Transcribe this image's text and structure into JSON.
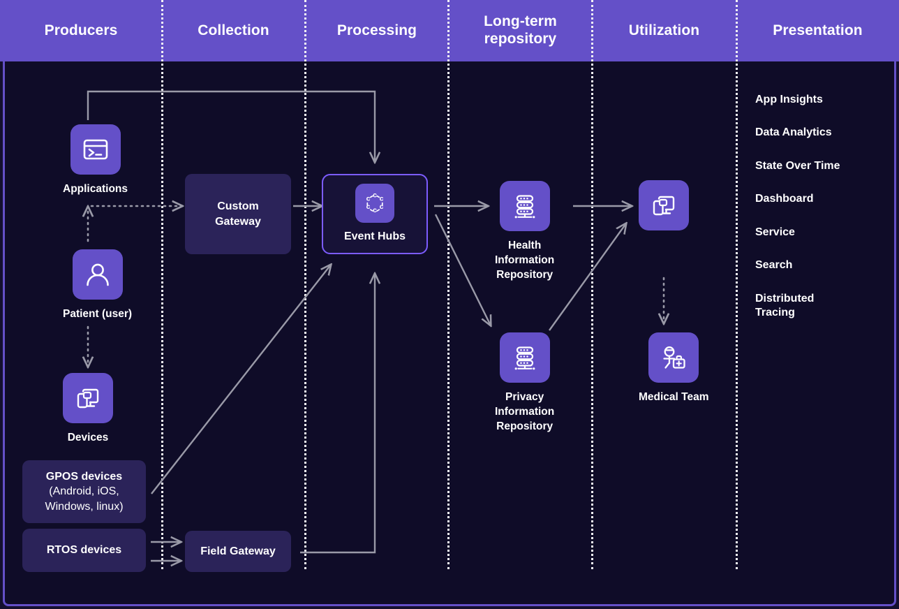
{
  "colors": {
    "header_band": "#6450c8",
    "canvas": "#0f0c28",
    "page": "#14102e",
    "tile_purple": "#6450c8",
    "box_navy": "#2b2359",
    "accent_border": "#7c5cff",
    "connector": "#9a9aa8",
    "divider": "#f2f2f5",
    "text": "#ffffff"
  },
  "header": {
    "columns": [
      {
        "label": "Producers"
      },
      {
        "label": "Collection"
      },
      {
        "label": "Processing"
      },
      {
        "label": "Long-term\nrepository"
      },
      {
        "label": "Utilization"
      },
      {
        "label": "Presentation"
      }
    ]
  },
  "producers": {
    "applications": {
      "label": "Applications",
      "icon": "terminal-window-icon"
    },
    "patient": {
      "label": "Patient (user)",
      "icon": "person-icon"
    },
    "devices": {
      "label": "Devices",
      "icon": "devices-icon"
    },
    "gpos_devices": {
      "title": "GPOS devices",
      "detail": "(Android, iOS,\nWindows, linux)"
    },
    "rtos_devices": {
      "label": "RTOS devices"
    }
  },
  "collection": {
    "custom_gateway": {
      "label": "Custom\nGateway"
    },
    "field_gateway": {
      "label": "Field Gateway"
    }
  },
  "processing": {
    "event_hubs": {
      "label": "Event Hubs",
      "icon": "event-hubs-icon"
    }
  },
  "repository": {
    "health_information_repository": {
      "label": "Health\nInformation\nRepository",
      "icon": "database-stack-icon"
    },
    "privacy_information_repository": {
      "label": "Privacy\nInformation\nRepository",
      "icon": "database-stack-icon"
    }
  },
  "utilization": {
    "devices": {
      "label": "",
      "icon": "devices-icon"
    },
    "medical_team": {
      "label": "Medical Team",
      "icon": "medical-team-icon"
    }
  },
  "presentation": {
    "items": [
      {
        "label": "App Insights"
      },
      {
        "label": "Data Analytics"
      },
      {
        "label": "State Over Time"
      },
      {
        "label": "Dashboard"
      },
      {
        "label": "Service"
      },
      {
        "label": "Search"
      },
      {
        "label": "Distributed\nTracing"
      }
    ]
  },
  "connections": [
    {
      "from": "applications",
      "to": "event-hubs",
      "style": "solid-elbow"
    },
    {
      "from": "patient",
      "to": "applications",
      "style": "dotted"
    },
    {
      "from": "patient",
      "to": "devices",
      "style": "dotted"
    },
    {
      "from": "applications",
      "to": "custom-gateway",
      "style": "dotted"
    },
    {
      "from": "custom-gateway",
      "to": "event-hubs",
      "style": "solid"
    },
    {
      "from": "gpos-devices",
      "to": "event-hubs",
      "style": "solid-diagonal"
    },
    {
      "from": "rtos-devices",
      "to": "field-gateway",
      "style": "solid"
    },
    {
      "from": "field-gateway",
      "to": "event-hubs",
      "style": "solid-elbow"
    },
    {
      "from": "event-hubs",
      "to": "health-information-repository",
      "style": "solid"
    },
    {
      "from": "event-hubs",
      "to": "privacy-information-repository",
      "style": "solid-diagonal"
    },
    {
      "from": "health-information-repository",
      "to": "utilization-devices",
      "style": "solid"
    },
    {
      "from": "privacy-information-repository",
      "to": "utilization-devices",
      "style": "solid-diagonal"
    },
    {
      "from": "utilization-devices",
      "to": "medical-team",
      "style": "dotted"
    }
  ]
}
